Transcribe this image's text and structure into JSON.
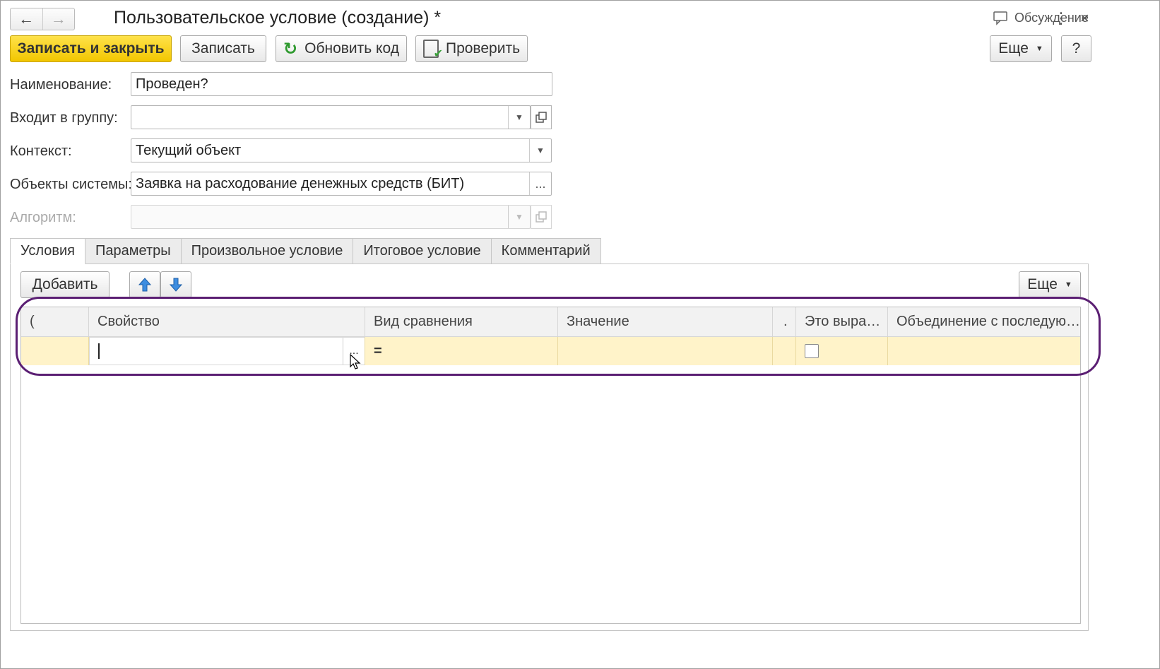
{
  "window": {
    "title": "Пользовательское условие (создание) *",
    "discussion_label": "Обсуждение",
    "back_icon": "←",
    "forward_icon": "→",
    "more_icon": "⋮",
    "close_icon": "×"
  },
  "toolbar": {
    "save_close": "Записать и закрыть",
    "save": "Записать",
    "refresh_code": "Обновить код",
    "check": "Проверить",
    "more": "Еще",
    "help": "?"
  },
  "form": {
    "name_label": "Наименование:",
    "name_value": "Проведен?",
    "group_label": "Входит в группу:",
    "group_value": "",
    "context_label": "Контекст:",
    "context_value": "Текущий объект",
    "objects_label": "Объекты системы:",
    "objects_value": "Заявка на расходование денежных средств (БИТ)",
    "objects_btn": "...",
    "algorithm_label": "Алгоритм:",
    "algorithm_value": ""
  },
  "tabs": [
    "Условия",
    "Параметры",
    "Произвольное условие",
    "Итоговое условие",
    "Комментарий"
  ],
  "conditions": {
    "add_button": "Добавить",
    "move_up_icon": "arrow-up-icon",
    "move_down_icon": "arrow-down-icon",
    "more": "Еще",
    "columns": [
      "(",
      "Свойство",
      "Вид сравнения",
      "Значение",
      ".",
      "Это выра…",
      "Объединение с последую…"
    ],
    "rows": [
      {
        "paren": "",
        "property": "",
        "property_btn": "...",
        "comparison": "=",
        "value": "",
        "dot": "",
        "is_expression": false,
        "union": ""
      }
    ]
  },
  "colors": {
    "primary_button": "#f2c600",
    "row_selected": "#fff3c9",
    "highlight_outline": "#5b1f73"
  }
}
